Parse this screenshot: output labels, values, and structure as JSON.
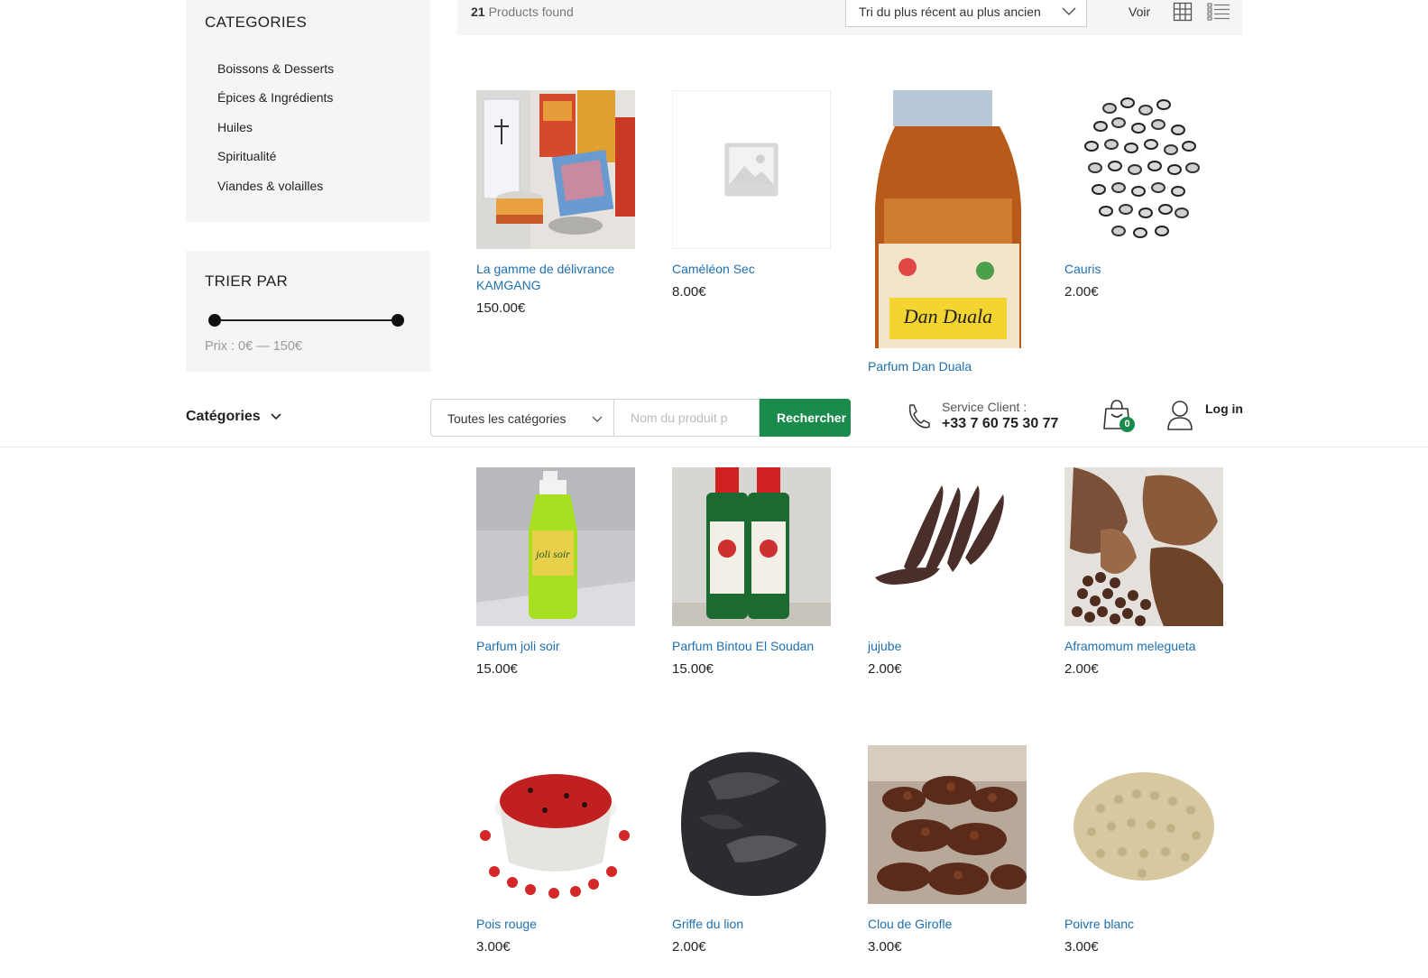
{
  "sidebar": {
    "categories": {
      "title": "CATEGORIES",
      "items": [
        "Boissons & Desserts",
        "Épices & Ingrédients",
        "Huiles",
        "Spiritualité",
        "Viandes & volailles"
      ]
    },
    "sort": {
      "title": "TRIER PAR",
      "price_label": "Prix :",
      "price_text": "0€ — 150€"
    }
  },
  "toolbar": {
    "count": "21",
    "found_label": "Products found",
    "sort_value": "Tri du plus récent au plus ancien",
    "view_label": "Voir"
  },
  "header": {
    "categories_toggle": "Catégories",
    "search_category": "Toutes les catégories",
    "search_placeholder": "Nom du produit p",
    "search_button": "Rechercher",
    "service_label": "Service Client :",
    "service_phone": "+33 7 60 75 30 77",
    "cart_count": "0",
    "login_label": "Log in"
  },
  "products": [
    {
      "name": "La gamme de délivrance KAMGANG",
      "price": "150.00€",
      "icon": "jars-photo"
    },
    {
      "name": "Caméléon Sec",
      "price": "8.00€",
      "icon": "placeholder-image-icon"
    },
    {
      "name": "Parfum Dan Duala",
      "price": "",
      "icon": "bottle-photo"
    },
    {
      "name": "Cauris",
      "price": "2.00€",
      "icon": "shells-photo"
    },
    {
      "name": "Parfum joli soir",
      "price": "15.00€",
      "icon": "green-bottle-photo"
    },
    {
      "name": "Parfum Bintou El Soudan",
      "price": "15.00€",
      "icon": "two-bottles-photo"
    },
    {
      "name": "jujube",
      "price": "2.00€",
      "icon": "pods-photo"
    },
    {
      "name": "Aframomum melegueta",
      "price": "2.00€",
      "icon": "seeds-photo"
    },
    {
      "name": "Pois rouge",
      "price": "3.00€",
      "icon": "red-peas-photo"
    },
    {
      "name": "Griffe du lion",
      "price": "2.00€",
      "icon": "dark-pods-photo"
    },
    {
      "name": "Clou de Girofle",
      "price": "3.00€",
      "icon": "cloves-photo"
    },
    {
      "name": "Poivre blanc",
      "price": "3.00€",
      "icon": "white-pepper-photo"
    }
  ],
  "colors": {
    "link": "#1e6fae",
    "brand_green": "#1a8b4a",
    "widget_bg": "#f5f5f5"
  }
}
